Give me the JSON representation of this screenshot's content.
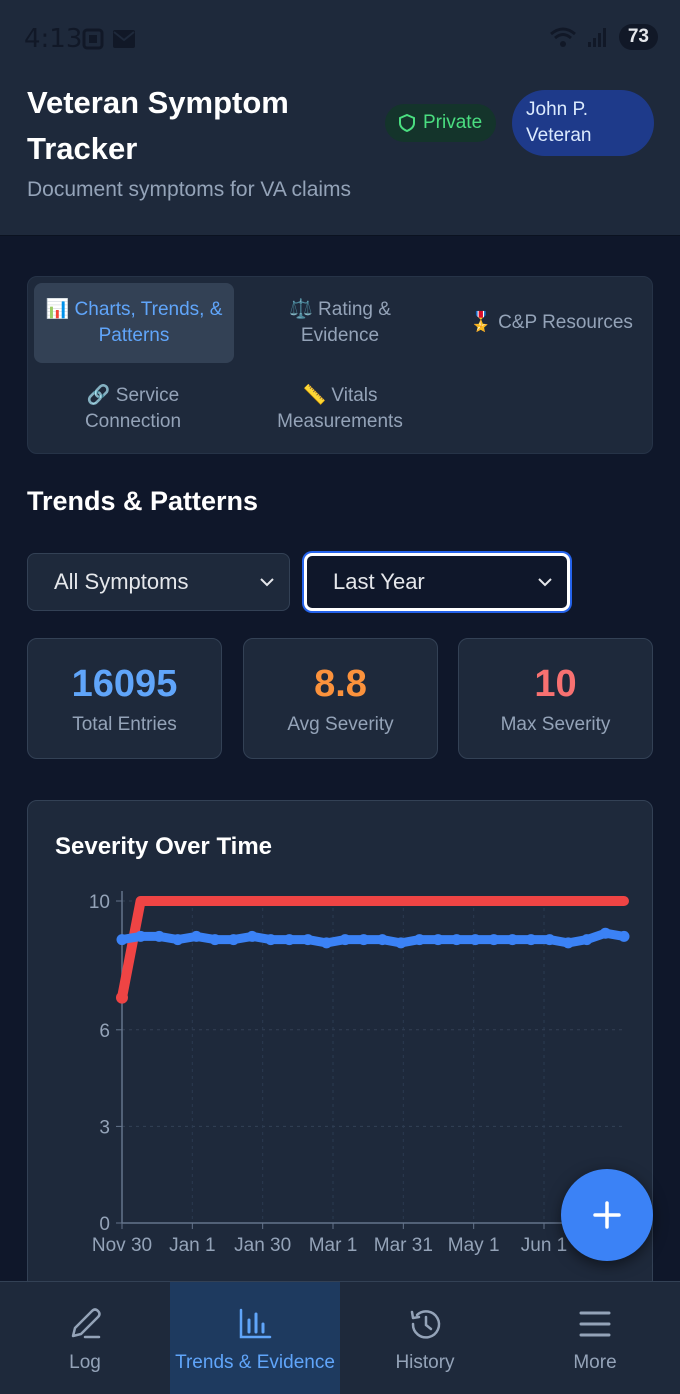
{
  "status_bar": {
    "time": "4:13",
    "battery": "73"
  },
  "header": {
    "title": "Veteran Symptom Tracker",
    "subtitle": "Document symptoms for VA claims",
    "privacy_badge": "Private",
    "user_name": "John P. Veteran"
  },
  "tabs": [
    {
      "icon": "📊",
      "label": "Charts, Trends, & Patterns",
      "active": true
    },
    {
      "icon": "⚖️",
      "label": "Rating & Evidence"
    },
    {
      "icon": "🎖️",
      "label": "C&P Resources"
    },
    {
      "icon": "🔗",
      "label": "Service Connection"
    },
    {
      "icon": "📏",
      "label": "Vitals Measurements"
    }
  ],
  "section": {
    "title": "Trends & Patterns"
  },
  "filters": {
    "symptom_select": "All Symptoms",
    "range_select": "Last Year"
  },
  "stats": [
    {
      "value": "16095",
      "label": "Total Entries",
      "color": "#60a5fa"
    },
    {
      "value": "8.8",
      "label": "Avg Severity",
      "color": "#fb923c"
    },
    {
      "value": "10",
      "label": "Max Severity",
      "color": "#f87171"
    }
  ],
  "chart_title": "Severity Over Time",
  "chart_data": {
    "type": "line",
    "title": "Severity Over Time",
    "x_tick_labels": [
      "Nov 30",
      "Jan 1",
      "Jan 30",
      "Mar 1",
      "Mar 31",
      "May 1",
      "Jun 1"
    ],
    "y_ticks": [
      0,
      3,
      6,
      10
    ],
    "ylim": [
      0,
      10
    ],
    "grid": true,
    "series": [
      {
        "color": "#ef4444",
        "values": [
          7,
          10,
          10,
          10,
          10,
          10,
          10,
          10,
          10,
          10,
          10,
          10,
          10,
          10,
          10,
          10,
          10,
          10,
          10,
          10,
          10,
          10,
          10,
          10,
          10,
          10,
          10,
          10
        ]
      },
      {
        "color": "#3b82f6",
        "values": [
          8.8,
          8.9,
          8.9,
          8.8,
          8.9,
          8.8,
          8.8,
          8.9,
          8.8,
          8.8,
          8.8,
          8.7,
          8.8,
          8.8,
          8.8,
          8.7,
          8.8,
          8.8,
          8.8,
          8.8,
          8.8,
          8.8,
          8.8,
          8.8,
          8.7,
          8.8,
          9.0,
          8.9
        ]
      }
    ]
  },
  "bottom_nav": [
    {
      "icon": "pencil-icon",
      "label": "Log"
    },
    {
      "icon": "bar-chart-icon",
      "label": "Trends & Evidence",
      "active": true
    },
    {
      "icon": "history-icon",
      "label": "History"
    },
    {
      "icon": "menu-icon",
      "label": "More"
    }
  ],
  "colors": {
    "accent": "#3b82f6",
    "background": "#0f172a",
    "surface": "#1e293b",
    "success": "#4ade80"
  }
}
